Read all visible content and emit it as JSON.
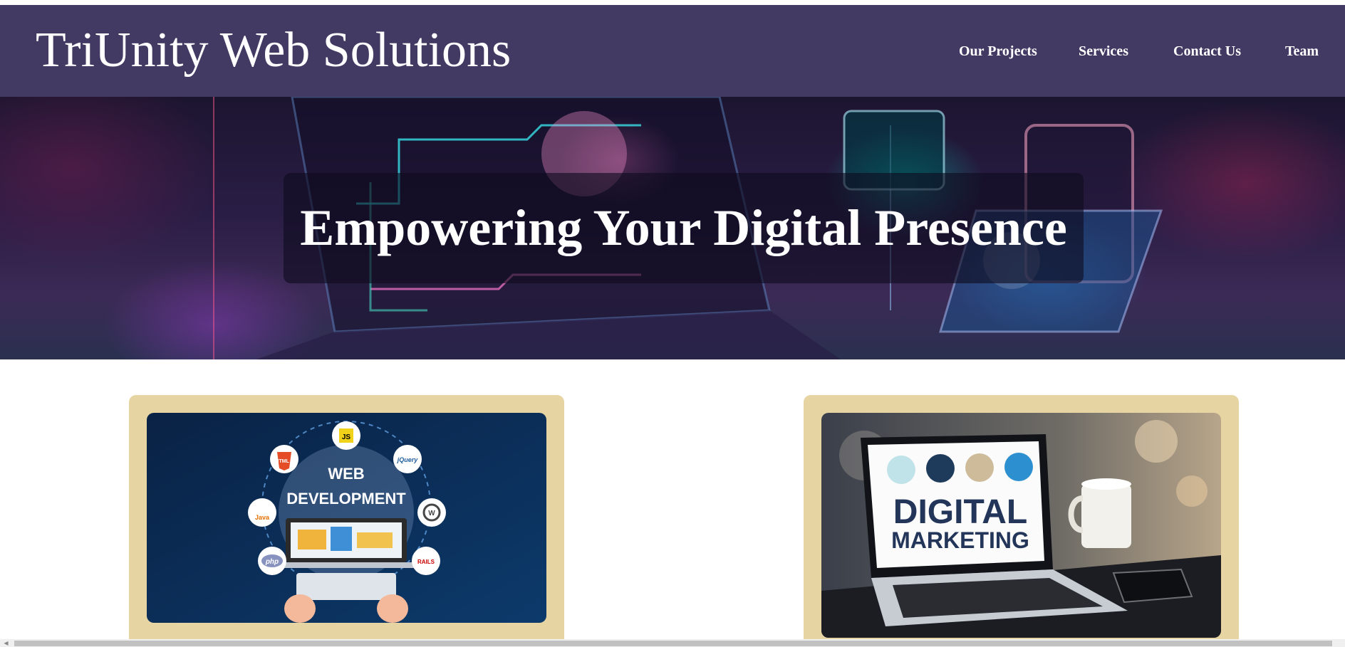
{
  "site": {
    "title": "TriUnity Web Solutions"
  },
  "nav": {
    "items": [
      {
        "label": "Our Projects"
      },
      {
        "label": "Services"
      },
      {
        "label": "Contact Us"
      },
      {
        "label": "Team"
      }
    ]
  },
  "hero": {
    "heading": "Empowering Your Digital Presence"
  },
  "cards": [
    {
      "image_text": [
        "WEB",
        "DEVELOPMENT"
      ],
      "badges": [
        "JS",
        "HTML 5",
        "jQuery",
        "Java",
        "php",
        "RAILS"
      ]
    },
    {
      "image_text": [
        "DIGITAL",
        "MARKETING"
      ]
    }
  ],
  "colors": {
    "header_bg": "#433a63",
    "card_bg": "#e6d4a2",
    "text_on_dark": "#ffffff"
  }
}
